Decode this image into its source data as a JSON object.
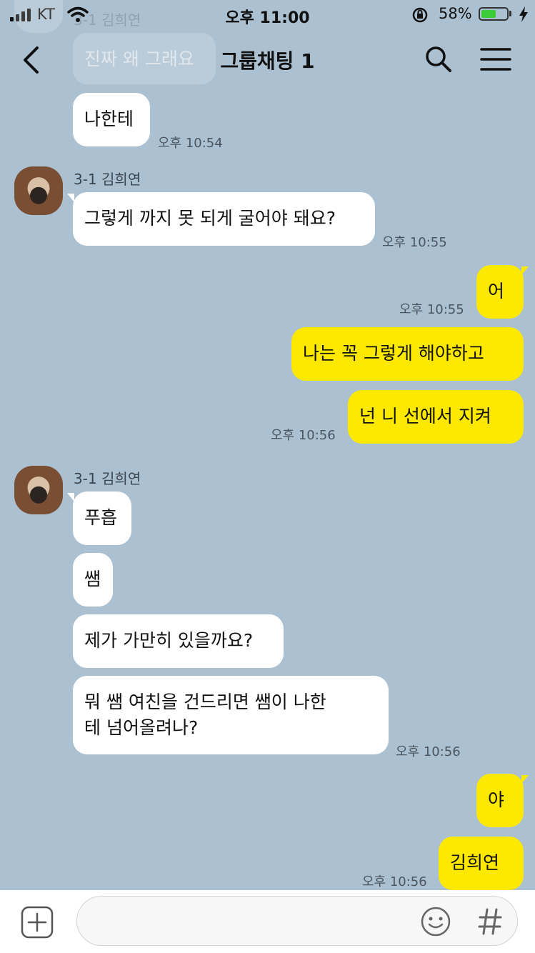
{
  "status": {
    "carrier": "KT",
    "time": "오후 11:00",
    "battery": "58%",
    "battery_level": 0.58
  },
  "header": {
    "title": "그룹채팅 1"
  },
  "ghost_message": {
    "sender": "3-1 김희연",
    "text": "진짜 왜 그래요"
  },
  "messages": [
    {
      "text": "나한테",
      "time": "오후 10:54"
    },
    {
      "sender": "3-1 김희연",
      "text": "그렇게 까지 못 되게 굴어야 돼요?",
      "time": "오후 10:55"
    },
    {
      "text": "어",
      "time": "오후 10:55"
    },
    {
      "text": "나는 꼭 그렇게 해야하고"
    },
    {
      "text": "넌 니 선에서 지켜",
      "time": "오후 10:56"
    },
    {
      "sender": "3-1 김희연",
      "text": "푸흡"
    },
    {
      "text": "쌤"
    },
    {
      "text": "제가 가만히 있을까요?"
    },
    {
      "text_line1": "뭐 쌤 여친을 건드리면 쌤이 나한",
      "text_line2": "테 넘어올려나?",
      "time": "오후 10:56"
    },
    {
      "text": "야"
    },
    {
      "text": "김희연",
      "time": "오후 10:56"
    }
  ],
  "colors": {
    "background": "#abc1d1",
    "my_bubble": "#fde800",
    "their_bubble": "#ffffff"
  },
  "icons": [
    "back-arrow-icon",
    "search-icon",
    "menu-icon",
    "plus-icon",
    "emoji-icon",
    "hash-icon"
  ]
}
